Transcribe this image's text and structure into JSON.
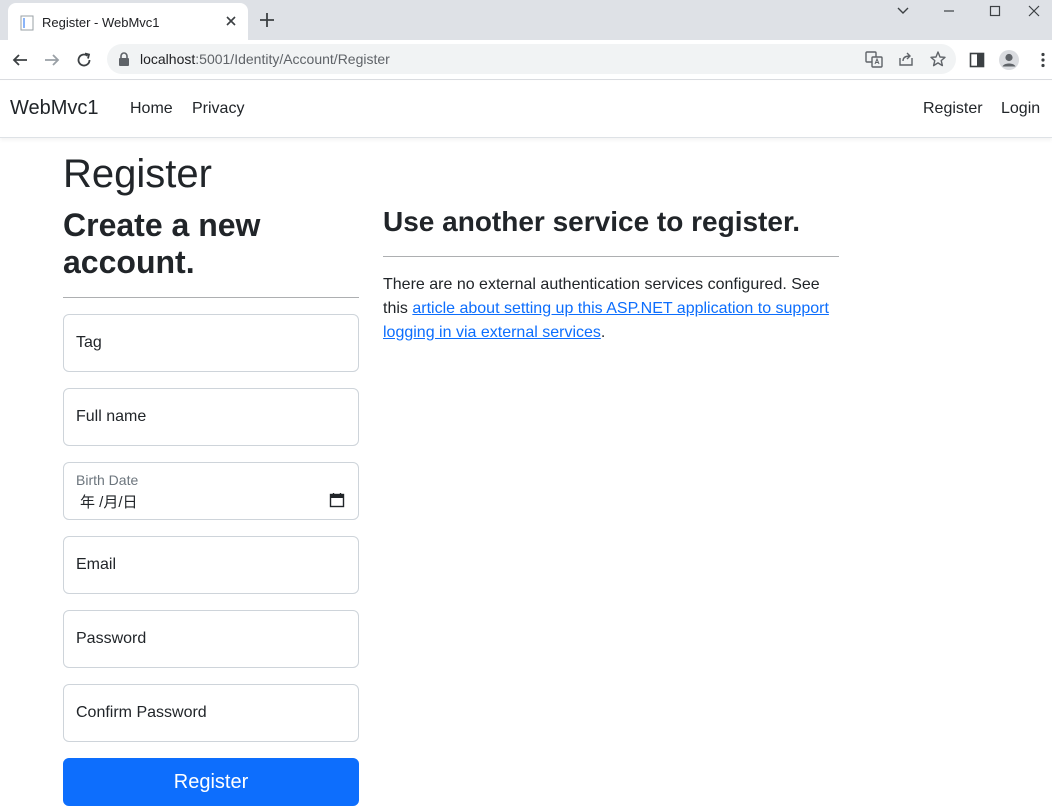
{
  "browser": {
    "tab_title": "Register - WebMvc1",
    "url_host": "localhost",
    "url_path": ":5001/Identity/Account/Register"
  },
  "navbar": {
    "brand": "WebMvc1",
    "links": [
      "Home",
      "Privacy"
    ],
    "right_links": [
      "Register",
      "Login"
    ]
  },
  "page": {
    "title": "Register",
    "subtitle": "Create a new account.",
    "fields": {
      "tag": "Tag",
      "full_name": "Full name",
      "birth_date_label": "Birth Date",
      "birth_date_value": "年 /月/日",
      "email": "Email",
      "password": "Password",
      "confirm_password": "Confirm Password"
    },
    "submit_label": "Register"
  },
  "external": {
    "heading": "Use another service to register.",
    "text_1": "There are no external authentication services configured. See this ",
    "link": "article about setting up this ASP.NET application to support logging in via external services",
    "text_2": "."
  },
  "colors": {
    "primary": "#0d6efd",
    "tabstrip": "#dee1e6"
  }
}
